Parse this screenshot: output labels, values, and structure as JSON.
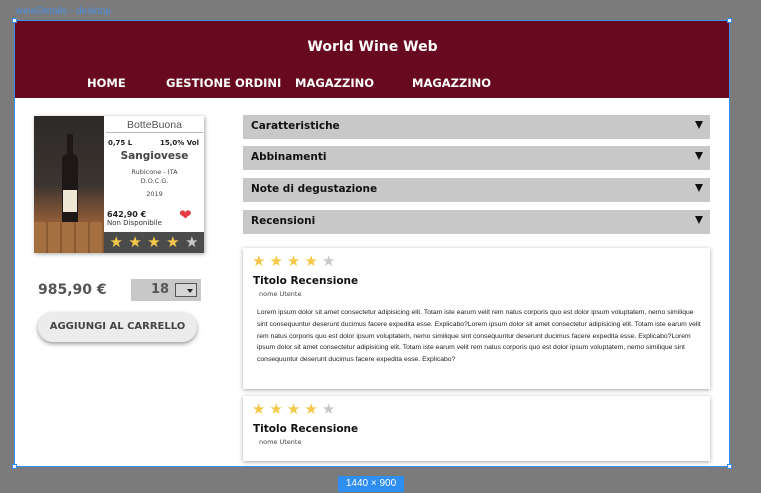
{
  "canvas": {
    "frame_label": "wineDetails - desktop",
    "size_badge": "1440 × 900"
  },
  "header": {
    "title": "World Wine Web",
    "nav": [
      "HOME",
      "GESTIONE ORDINI",
      "MAGAZZINO",
      "MAGAZZINO"
    ]
  },
  "product": {
    "brand": "BotteBuona",
    "volume": "0,75 L",
    "alcohol": "15,0% Vol",
    "name": "Sangiovese",
    "origin": "Rubicone - ITA",
    "classification": "D.O.C.G.",
    "year": "2019",
    "card_price": "642,90 €",
    "availability": "Non Disponibile",
    "rating": 4,
    "rating_max": 5,
    "favorite": true,
    "price": "985,90 €",
    "quantity": "18",
    "add_to_cart_label": "AGGIUNGI AL CARRELLO"
  },
  "accordions": [
    "Caratteristiche",
    "Abbinamenti",
    "Note di degustazione",
    "Recensioni"
  ],
  "reviews": [
    {
      "rating": 4,
      "title": "Titolo Recensione",
      "user": "nome Utente",
      "text": "Lorem ipsum dolor sit amet consectetur adipisicing elit. Totam iste earum velit rem natus corporis quo est dolor ipsum voluptatem, nemo similique sint consequuntur deserunt ducimus facere expedita esse. Explicabo?Lorem ipsum dolor sit amet consectetur adipisicing elit. Totam iste earum velit rem natus corporis quo est dolor ipsum voluptatem, nemo similique sint consequuntur deserunt ducimus facere expedita esse. Explicabo?Lorem ipsum dolor sit amet consectetur adipisicing elit. Totam iste earum velit rem natus corporis quo est dolor ipsum voluptatem, nemo similique sint consequuntur deserunt ducimus facere expedita esse. Explicabo?"
    },
    {
      "rating": 4,
      "title": "Titolo Recensione",
      "user": "nome Utente",
      "text": ""
    }
  ],
  "colors": {
    "header_bg": "#670a20",
    "star_gold": "#f5c84a",
    "star_gray": "#c8c8c8",
    "heart": "#e53945",
    "accordion_bg": "#c8c8c8"
  },
  "icons": {
    "favorite": "heart-icon",
    "rating": "star-icon",
    "accordion": "triangle-down-icon",
    "quantity": "chevron-down-icon"
  }
}
